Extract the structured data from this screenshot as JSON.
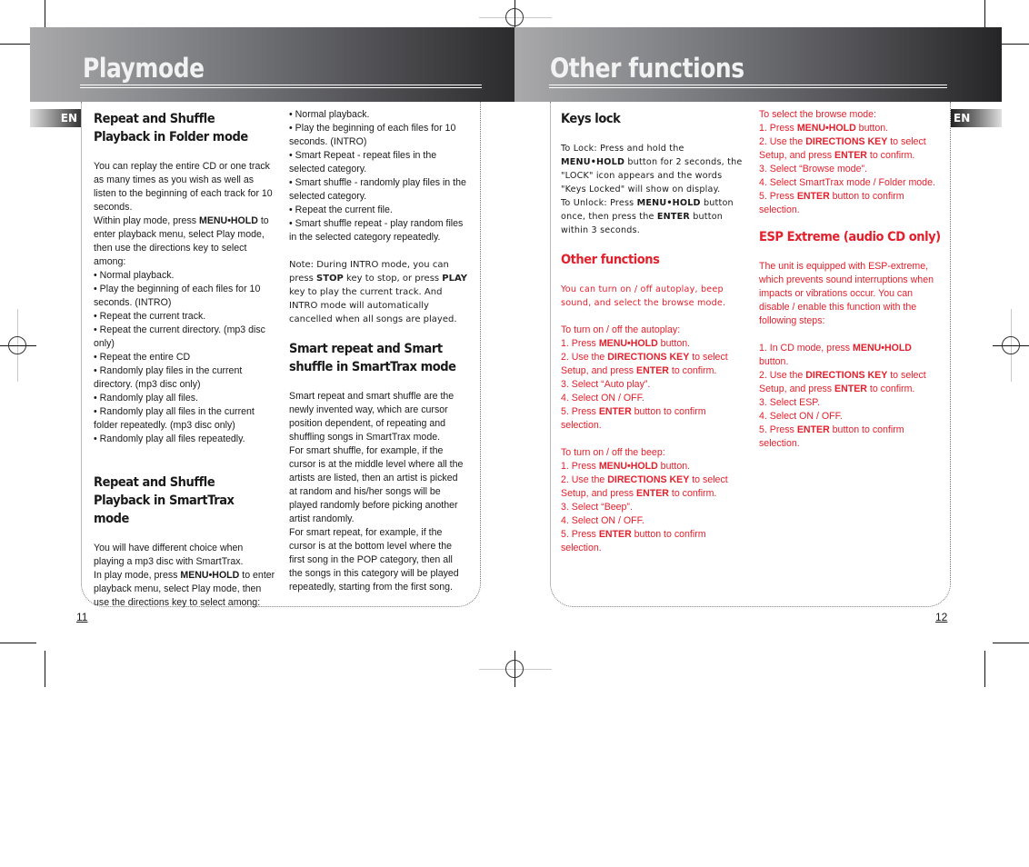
{
  "left_page": {
    "title": "Playmode",
    "lang_tag": "EN",
    "page_number": "11",
    "col1": {
      "heading1": "Repeat and Shuffle Playback in Folder mode",
      "intro": "You can replay the entire CD or one track as many times as you wish as well as listen to the beginning of each track for 10 seconds.",
      "instr_pre": "Within play mode, press ",
      "instr_key": "MENU•HOLD",
      "instr_post": " to enter playback menu, select Play mode, then use the directions key to select among:",
      "bullets": [
        "Normal playback.",
        "Play the beginning of each files for 10 seconds. (INTRO)",
        "Repeat the current track.",
        "Repeat the current directory. (mp3 disc only)",
        "Repeat the entire CD",
        "Randomly play files in the current directory. (mp3 disc only)",
        "Randomly play all files.",
        "Randomly play all files in the current folder repeatedly. (mp3 disc only)",
        "Randomly play all files repeatedly."
      ],
      "heading2": "Repeat and Shuffle Playback in SmartTrax mode",
      "smart_intro": "You will have different choice when playing a mp3 disc with SmartTrax.",
      "smart_pre": "In play mode, press ",
      "smart_key": "MENU•HOLD",
      "smart_post": " to enter playback menu, select Play mode, then use the directions key to select among:"
    },
    "col2": {
      "bullets": [
        "Normal playback.",
        "Play the beginning of each files for 10 seconds. (INTRO)",
        "Smart Repeat - repeat files in the selected category.",
        "Smart shuffle - randomly play files in the selected category.",
        "Repeat the current file.",
        "Smart shuffle repeat - play random files in the selected category repeatedly."
      ],
      "note_a": "Note: During INTRO mode, you can press ",
      "note_stop": "STOP",
      "note_b": " key to stop, or press ",
      "note_play": "PLAY",
      "note_c": " key to play the current track. And INTRO mode will automatically cancelled when all songs are played.",
      "heading": "Smart repeat and Smart shuffle in SmartTrax mode",
      "para1": "Smart repeat and smart shuffle are the newly invented way, which are cursor position dependent, of repeating and shuffling songs in SmartTrax mode.",
      "para2": "For smart shuffle, for example, if the cursor is at the middle level where all the artists are listed, then an artist is picked at random and his/her songs will be played randomly before picking another artist randomly.",
      "para3": "For smart repeat, for example, if the cursor is at the bottom level where the first song in the POP category, then all the songs in this category will be played repeatedly, starting from the first song."
    }
  },
  "right_page": {
    "title": "Other functions",
    "lang_tag": "EN",
    "page_number": "12",
    "col1": {
      "keys_heading": "Keys lock",
      "lock_a": "To Lock: Press and hold the ",
      "lock_key": "MENU•HOLD",
      "lock_b": " button for 2 seconds, the \"LOCK\" icon appears and the words \"Keys Locked\" will show on display.",
      "unlock_a": "To Unlock: Press ",
      "unlock_key": "MENU•HOLD",
      "unlock_b": " button once, then press the ",
      "unlock_enter": "ENTER",
      "unlock_c": " button within 3 seconds.",
      "other_heading": "Other functions",
      "other_intro": "You can turn on / off autoplay, beep sound, and select the browse mode.",
      "autoplay": {
        "title": "To turn on / off the autoplay:",
        "s1_a": "1. Press ",
        "s1_key": "MENU•HOLD",
        "s1_b": " button.",
        "s2_a": "2. Use the ",
        "s2_key": "DIRECTIONS KEY",
        "s2_b": " to select Setup, and press ",
        "s2_enter": "ENTER",
        "s2_c": " to confirm.",
        "s3": "3. Select “Auto play”.",
        "s4": "4. Select ON / OFF.",
        "s5_a": "5. Press ",
        "s5_key": "ENTER",
        "s5_b": " button to confirm selection."
      },
      "beep": {
        "title": "To turn on / off the beep:",
        "s1_a": "1. Press ",
        "s1_key": "MENU•HOLD",
        "s1_b": " button.",
        "s2_a": "2. Use the ",
        "s2_key": "DIRECTIONS KEY",
        "s2_b": " to select Setup, and press ",
        "s2_enter": "ENTER",
        "s2_c": " to confirm.",
        "s3": "3. Select “Beep”.",
        "s4": "4. Select ON / OFF.",
        "s5_a": "5. Press ",
        "s5_key": "ENTER",
        "s5_b": " button to confirm selection."
      }
    },
    "col2": {
      "browse": {
        "title": "To select the browse mode:",
        "s1_a": "1. Press ",
        "s1_key": "MENU•HOLD",
        "s1_b": " button.",
        "s2_a": "2. Use the ",
        "s2_key": "DIRECTIONS KEY",
        "s2_b": " to select Setup, and press ",
        "s2_enter": "ENTER",
        "s2_c": " to confirm.",
        "s3": "3. Select “Browse mode”.",
        "s4": "4. Select SmartTrax mode / Folder mode.",
        "s5_a": "5. Press ",
        "s5_key": "ENTER",
        "s5_b": " button to confirm selection."
      },
      "esp_heading": "ESP Extreme (audio CD only)",
      "esp_intro": "The unit is equipped with ESP-extreme, which prevents sound interruptions when impacts or vibrations occur.  You can disable / enable this function with the following steps:",
      "esp": {
        "s1_a": "1. In CD mode, press ",
        "s1_key": "MENU•HOLD",
        "s1_b": " button.",
        "s2_a": "2. Use the ",
        "s2_key": "DIRECTIONS KEY",
        "s2_b": " to select Setup, and press ",
        "s2_enter": "ENTER",
        "s2_c": " to confirm.",
        "s3": "3. Select ESP.",
        "s4": "4. Select ON / OFF.",
        "s5_a": "5. Press ",
        "s5_key": "ENTER",
        "s5_b": " button to confirm selection."
      }
    }
  },
  "colors": {
    "accent_red": "#e3202c",
    "header_dark": "#2b2a2c",
    "header_light": "#a9a9ab"
  }
}
